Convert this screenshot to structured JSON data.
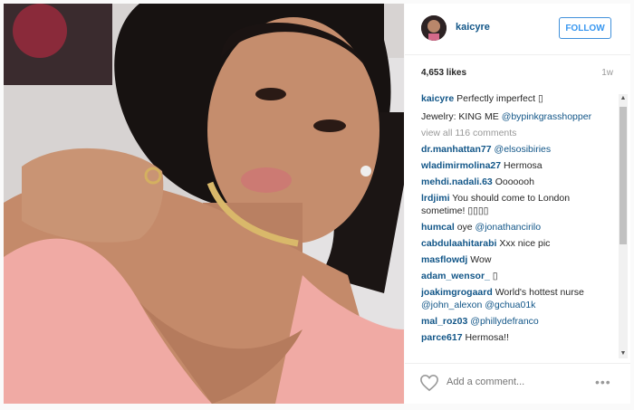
{
  "post": {
    "username": "kaicyre",
    "follow_label": "FOLLOW",
    "likes": "4,653 likes",
    "time_ago": "1w"
  },
  "caption": {
    "user": "kaicyre",
    "text": "Perfectly imperfect ▯"
  },
  "caption2": {
    "text": "Jewelry: KING ME ",
    "mention": "@bypinkgrasshopper"
  },
  "view_all": "view all 116 comments",
  "comments": [
    {
      "user": "dr.manhattan77",
      "text": "",
      "mention": "@elsosibiries"
    },
    {
      "user": "wladimirmolina27",
      "text": "Hermosa",
      "mention": ""
    },
    {
      "user": "mehdi.nadali.63",
      "text": "Ooooooh",
      "mention": ""
    },
    {
      "user": "lrdjimi",
      "text": "You should come to London sometime! ▯▯▯▯",
      "mention": ""
    },
    {
      "user": "humcal",
      "text": "oye",
      "mention": "@jonathancirilo"
    },
    {
      "user": "cabdulaahitarabi",
      "text": "Xxx nice pic",
      "mention": ""
    },
    {
      "user": "masflowdj",
      "text": "Wow",
      "mention": ""
    },
    {
      "user": "adam_wensor_",
      "text": "▯",
      "mention": ""
    },
    {
      "user": "joakimgrogaard",
      "text": "World's hottest nurse",
      "mention": "@john_alexon @gchua01k"
    },
    {
      "user": "mal_roz03",
      "text": "",
      "mention": "@phillydefranco"
    },
    {
      "user": "parce617",
      "text": "Hermosa!!",
      "mention": ""
    }
  ],
  "footer": {
    "add_comment_placeholder": "Add a comment...",
    "more_glyph": "•••"
  },
  "icons": {
    "heart": "heart-icon",
    "more": "more-options-icon",
    "avatar": "avatar"
  },
  "colors": {
    "link": "#125688",
    "follow": "#3897f0",
    "muted": "#999999"
  }
}
